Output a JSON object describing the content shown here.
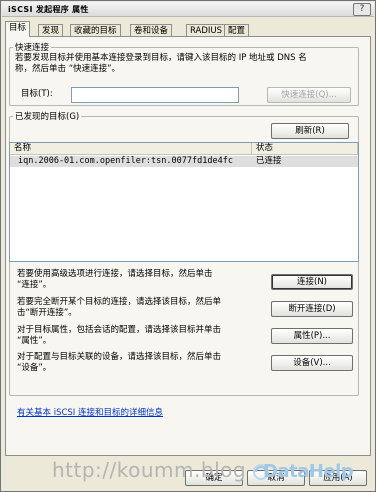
{
  "window": {
    "title": "iSCSI 发起程序 属性",
    "help_button": "?"
  },
  "tabs": [
    "目标",
    "发现",
    "收藏的目标",
    "卷和设备",
    "RADIUS",
    "配置"
  ],
  "quick_connect": {
    "legend": "快速连接",
    "description_line1": "若要发现目标并使用基本连接登录到目标，请键入该目标的 IP 地址或 DNS 名",
    "description_line2": "称，然后单击 “快速连接”。",
    "target_label": "目标(T):",
    "target_value": "",
    "quick_connect_button": "快速连接(Q)..."
  },
  "discovered_targets": {
    "legend": "已发现的目标(G)",
    "refresh_button": "刷新(R)",
    "columns": [
      "名称",
      "状态"
    ],
    "rows": [
      {
        "name": "iqn.2006-01.com.openfiler:tsn.0077fd1de4fc",
        "status": "已连接"
      }
    ]
  },
  "actions": [
    {
      "line1": "若要使用高级选项进行连接，请选择目标，然后单击",
      "line2": "“连接”。",
      "button": "连接(N)"
    },
    {
      "line1": "若要完全断开某个目标的连接，请选择该目标，然后单",
      "line2": "击“断开连接”。",
      "button": "断开连接(D)"
    },
    {
      "line1": "对于目标属性，包括会话的配置，请选择该目标并单击",
      "line2": "“属性”。",
      "button": "属性(P)..."
    },
    {
      "line1": "对于配置与目标关联的设备，请选择该目标，然后单击",
      "line2": "“设备”。",
      "button": "设备(V)..."
    }
  ],
  "help_link": "有关基本 iSCSI 连接和目标的详细信息",
  "footer_buttons": [
    "确定",
    "取消",
    "应用(A)"
  ],
  "watermark": {
    "url_text": "http://koumm.blog",
    "logo_text": "DataHelp"
  },
  "colors": {
    "dialog_bg": "#ece9d8",
    "link": "#0033cc",
    "selected_row": "#dedede"
  }
}
